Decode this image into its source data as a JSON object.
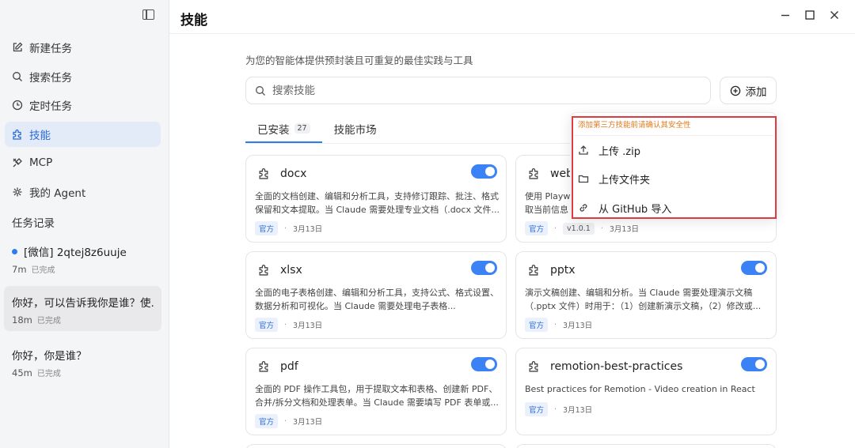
{
  "header": {
    "title": "技能"
  },
  "sidebar": {
    "items": [
      {
        "label": "新建任务",
        "icon": "edit-icon"
      },
      {
        "label": "搜索任务",
        "icon": "search-icon"
      },
      {
        "label": "定时任务",
        "icon": "clock-icon"
      },
      {
        "label": "技能",
        "icon": "puzzle-icon",
        "active": true
      },
      {
        "label": "MCP",
        "icon": "plug-icon"
      },
      {
        "label": "我的 Agent",
        "icon": "bot-icon"
      }
    ],
    "history_title": "任务记录",
    "tasks": [
      {
        "title": "[微信] 2qtej8z6uuje",
        "time": "7m",
        "status": "已完成",
        "dot": true
      },
      {
        "title": "你好，可以告诉我你是谁？使...",
        "time": "18m",
        "status": "已完成",
        "selected": true
      },
      {
        "title": "你好，你是谁？",
        "time": "45m",
        "status": "已完成"
      }
    ]
  },
  "main": {
    "subtitle": "为您的智能体提供预封装且可重复的最佳实践与工具",
    "search_placeholder": "搜索技能",
    "add_label": "添加",
    "tabs": [
      {
        "label": "已安装",
        "count": "27",
        "active": true
      },
      {
        "label": "技能市场"
      }
    ],
    "cards": [
      {
        "name": "docx",
        "desc": "全面的文档创建、编辑和分析工具，支持修订跟踪、批注、格式保留和文本提取。当 Claude 需要处理专业文档（.docx 文件...",
        "badge": "官方",
        "date": "3月13日",
        "enabled": true
      },
      {
        "name": "web",
        "desc": "使用 Playw 取当前信息",
        "badge": "官方",
        "version": "v1.0.1",
        "date": "3月13日",
        "enabled": true
      },
      {
        "name": "xlsx",
        "desc": "全面的电子表格创建、编辑和分析工具，支持公式、格式设置、数据分析和可视化。当 Claude 需要处理电子表格...",
        "badge": "官方",
        "date": "3月13日",
        "enabled": true
      },
      {
        "name": "pptx",
        "desc": "演示文稿创建、编辑和分析。当 Claude 需要处理演示文稿（.pptx 文件）时用于：（1）创建新演示文稿，（2）修改或...",
        "badge": "官方",
        "date": "3月13日",
        "enabled": true
      },
      {
        "name": "pdf",
        "desc": "全面的 PDF 操作工具包，用于提取文本和表格、创建新 PDF、合并/拆分文档和处理表单。当 Claude 需要填写 PDF 表单或...",
        "badge": "官方",
        "date": "3月13日",
        "enabled": true
      },
      {
        "name": "remotion-best-practices",
        "desc": "Best practices for Remotion - Video creation in React",
        "badge": "官方",
        "date": "3月13日",
        "enabled": true
      }
    ]
  },
  "dropdown": {
    "warning": "添加第三方技能前请确认其安全性",
    "items": [
      {
        "label": "上传 .zip",
        "icon": "upload-icon"
      },
      {
        "label": "上传文件夹",
        "icon": "folder-icon"
      },
      {
        "label": "从 GitHub 导入",
        "icon": "link-icon"
      }
    ]
  },
  "colors": {
    "accent": "#2f7bf0",
    "warning_border": "#e0393e",
    "warning_text": "#e07a1f"
  }
}
